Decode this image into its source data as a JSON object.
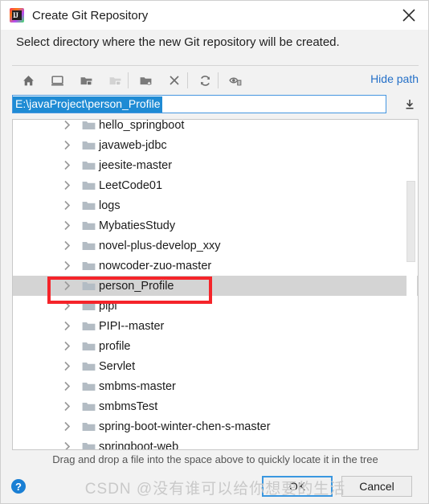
{
  "window": {
    "title": "Create Git Repository",
    "app_icon": "intellij-idea-icon",
    "close_label": "×"
  },
  "subtitle": "Select directory where the new Git repository will be created.",
  "toolbar": {
    "buttons": [
      {
        "name": "home-icon",
        "tooltip": "Home",
        "disabled": false
      },
      {
        "name": "desktop-icon",
        "tooltip": "Desktop",
        "disabled": false
      },
      {
        "name": "project-folder-icon",
        "tooltip": "Project Directory",
        "disabled": false
      },
      {
        "name": "module-folder-icon",
        "tooltip": "Module Directory",
        "disabled": true
      },
      {
        "name": "new-folder-icon",
        "tooltip": "New Folder",
        "disabled": false
      },
      {
        "name": "delete-icon",
        "tooltip": "Delete",
        "disabled": false
      },
      {
        "name": "refresh-icon",
        "tooltip": "Refresh",
        "disabled": false
      },
      {
        "name": "show-hidden-files-icon",
        "tooltip": "Show Hidden Files and Directories",
        "disabled": false
      }
    ],
    "hide_path_label": "Hide path"
  },
  "path_field": {
    "value": "E:\\javaProject\\person_Profile",
    "selected": true,
    "dropdown_icon": "download-arrow-icon"
  },
  "tree": {
    "items": [
      {
        "label": "hello_springboot",
        "selected": false
      },
      {
        "label": "javaweb-jdbc",
        "selected": false
      },
      {
        "label": "jeesite-master",
        "selected": false
      },
      {
        "label": "LeetCode01",
        "selected": false
      },
      {
        "label": "logs",
        "selected": false
      },
      {
        "label": "MybatiesStudy",
        "selected": false
      },
      {
        "label": "novel-plus-develop_xxy",
        "selected": false
      },
      {
        "label": "nowcoder-zuo-master",
        "selected": false
      },
      {
        "label": "person_Profile",
        "selected": true
      },
      {
        "label": "pipi",
        "selected": false
      },
      {
        "label": "PIPI--master",
        "selected": false
      },
      {
        "label": "profile",
        "selected": false
      },
      {
        "label": "Servlet",
        "selected": false
      },
      {
        "label": "smbms-master",
        "selected": false
      },
      {
        "label": "smbmsTest",
        "selected": false
      },
      {
        "label": "spring-boot-winter-chen-s-master",
        "selected": false
      },
      {
        "label": "springboot-web",
        "selected": false
      }
    ]
  },
  "hint": "Drag and drop a file into the space above to quickly locate it in the tree",
  "footer": {
    "help_label": "?",
    "ok_label": "OK",
    "cancel_label": "Cancel"
  },
  "watermark": "CSDN @没有谁可以给你想要的生活",
  "colors": {
    "accent_blue": "#2470c8",
    "selection_blue": "#1f8bd4",
    "annotation_red": "#f5242a",
    "row_selected_gray": "#d4d4d4"
  }
}
